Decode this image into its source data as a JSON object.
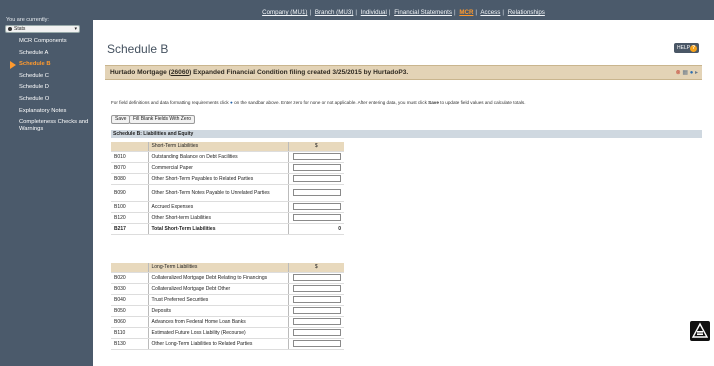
{
  "sidebar": {
    "label": "You are currently:",
    "select_value": "Stats",
    "items": [
      {
        "label": "MCR Components",
        "active": false
      },
      {
        "label": "Schedule A",
        "active": false
      },
      {
        "label": "Schedule B",
        "active": true
      },
      {
        "label": "Schedule C",
        "active": false
      },
      {
        "label": "Schedule D",
        "active": false
      },
      {
        "label": "Schedule O",
        "active": false
      },
      {
        "label": "Explanatory Notes",
        "active": false
      },
      {
        "label": "Completeness Checks and Warnings",
        "active": false
      }
    ]
  },
  "topnav": {
    "links": [
      "Company (MU1)",
      "Branch (MU3)",
      "Individual",
      "Financial Statements",
      "MCR",
      "Access",
      "Relationships"
    ],
    "active_index": 4
  },
  "page": {
    "title": "Schedule B",
    "help_label": "HELP",
    "help_icon": "?"
  },
  "filing": {
    "prefix": "Hurtado Mortgage (",
    "code": "26060",
    "suffix": ") Expanded Financial Condition filing created 3/25/2015 by HurtadoP3."
  },
  "instructions": {
    "before": "For field definitions and data formatting requirements click",
    "after": "on the sandbar above. Enter zero for none or not applicable. After entering data, you must click",
    "save_word": "Save",
    "end": "to update field values and calculate totals."
  },
  "buttons": {
    "save": "Save",
    "fill": "Fill Blank Fields With Zero"
  },
  "section_header": "Schedule B: Liabilities and Equity",
  "short_term": {
    "header": "Short-Term Liabilities",
    "unit": "$",
    "rows": [
      {
        "code": "B010",
        "desc": "Outstanding Balance on Debt Facilities"
      },
      {
        "code": "B070",
        "desc": "Commercial Paper"
      },
      {
        "code": "B080",
        "desc": "Other Short-Term Payables to Related Parties"
      },
      {
        "code": "B090",
        "desc": "Other Short-Term Notes Payable to Unrelated Parties"
      },
      {
        "code": "B100",
        "desc": "Accrued Expenses"
      },
      {
        "code": "B120",
        "desc": "Other Short-term Liabilities"
      }
    ],
    "total": {
      "code": "B217",
      "desc": "Total Short-Term Liabilities",
      "value": "0"
    }
  },
  "long_term": {
    "header": "Long-Term Liabilities",
    "unit": "$",
    "rows": [
      {
        "code": "B020",
        "desc": "Collateralized Mortgage Debt Relating to Financings"
      },
      {
        "code": "B030",
        "desc": "Collateralized Mortgage Debt Other"
      },
      {
        "code": "B040",
        "desc": "Trust Preferred Securities"
      },
      {
        "code": "B050",
        "desc": "Deposits"
      },
      {
        "code": "B060",
        "desc": "Advances from Federal Home Loan Banks"
      },
      {
        "code": "B110",
        "desc": "Estimated Future Loss Liability (Recourse)"
      },
      {
        "code": "B130",
        "desc": "Other Long-Term Liabilities to Related Parties"
      }
    ]
  }
}
